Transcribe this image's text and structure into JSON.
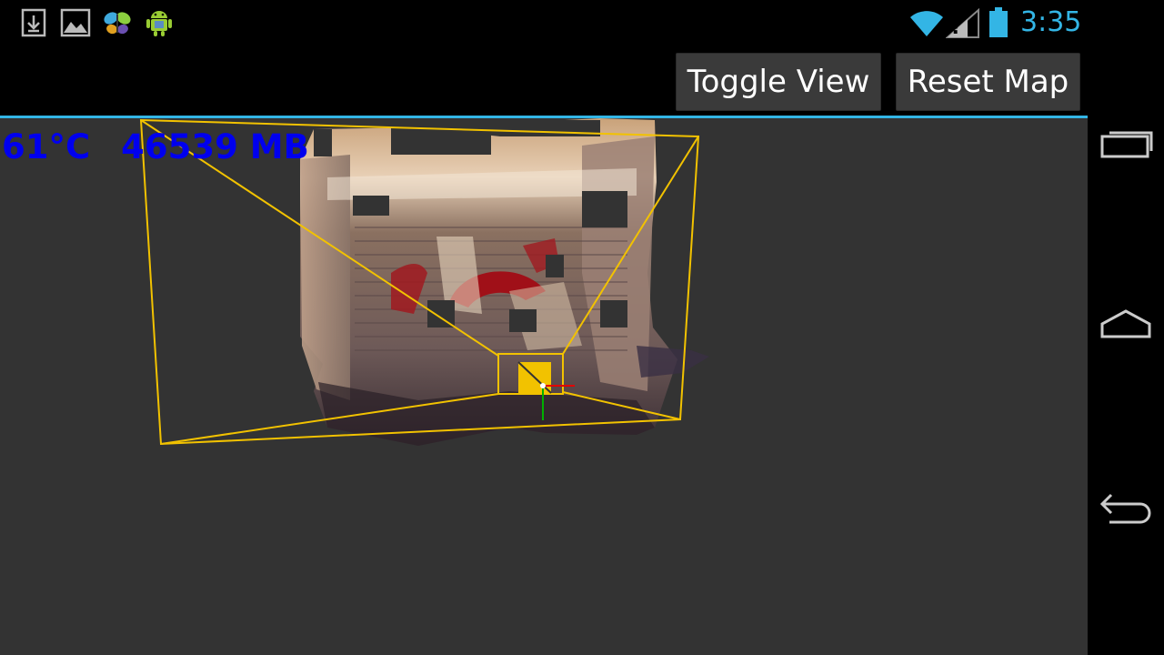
{
  "status_bar": {
    "notification_icons": [
      "download-icon",
      "gallery-icon",
      "butterfly-app-icon",
      "android-robot-icon"
    ],
    "system_icons": [
      "wifi-icon",
      "signal-unknown-icon",
      "battery-icon"
    ],
    "clock": "3:35"
  },
  "action_bar": {
    "toggle_view_label": "Toggle View",
    "reset_map_label": "Reset Map"
  },
  "viewport": {
    "temperature": "61°C",
    "memory": "46539 MB"
  },
  "nav_bar": {
    "icons": [
      "recent-apps-icon",
      "home-icon",
      "back-icon"
    ]
  },
  "colors": {
    "accent": "#33b5e5",
    "overlay_text": "#0000ee",
    "frustum": "#f2c200",
    "viewport_bg": "#333333"
  }
}
